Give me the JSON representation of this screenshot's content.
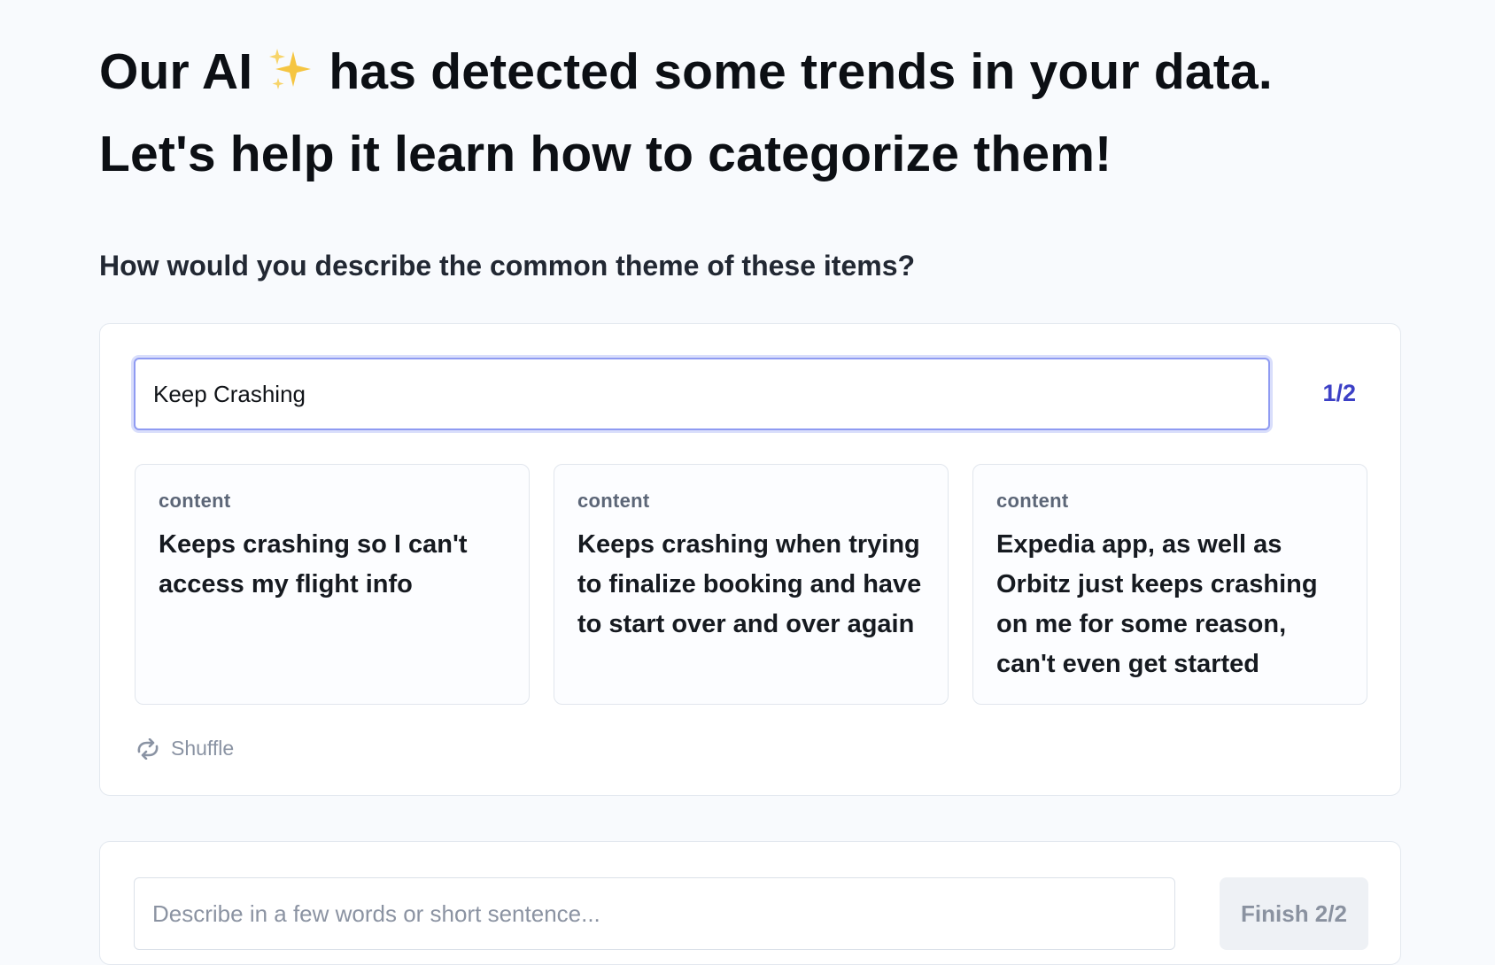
{
  "header": {
    "line1_before_icon": "Our AI ",
    "line1_icon": "sparkles-icon",
    "line1_after_icon": " has detected some trends in your data.",
    "line2": "Let's help it learn how to categorize them!"
  },
  "question": "How would you describe the common theme of these items?",
  "theme_card": {
    "input_value": "Keep Crashing",
    "counter": "1/2",
    "items": [
      {
        "label": "content",
        "text": "Keeps crashing so I can't access my flight info"
      },
      {
        "label": "content",
        "text": "Keeps crashing when trying to finalize booking and have to start over and over again"
      },
      {
        "label": "content",
        "text": "Expedia app, as well as Orbitz just keeps crashing on me for some reason, can't even get started"
      }
    ],
    "shuffle_label": "Shuffle",
    "shuffle_icon": "shuffle-icon"
  },
  "next_card": {
    "input_placeholder": "Describe in a few words or short sentence...",
    "input_value": "",
    "finish_label": "Finish 2/2"
  },
  "colors": {
    "background": "#f8fafd",
    "accent": "#3c40c6",
    "input_focus_border": "#8f9bf2",
    "sparkle": "#f5c542"
  }
}
